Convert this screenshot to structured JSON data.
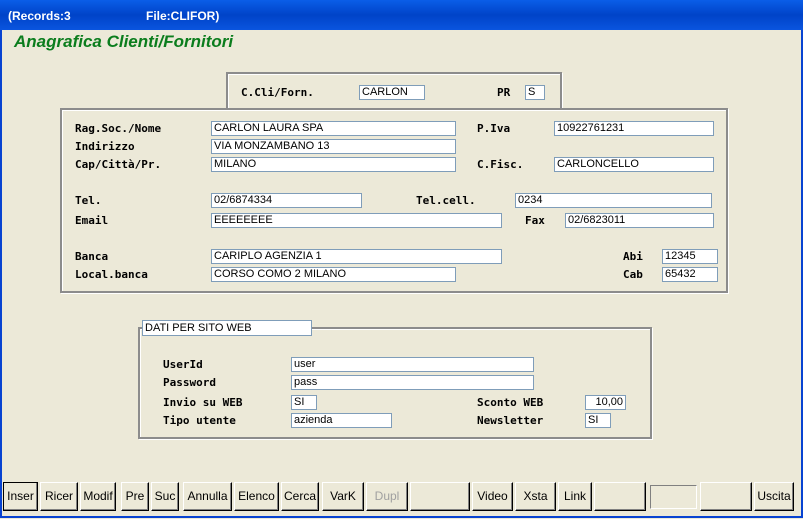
{
  "titlebar": {
    "records": "(Records:3",
    "file": "File:CLIFOR)"
  },
  "heading": "Anagrafica Clienti/Fornitori",
  "code": {
    "label": "C.Cli/Forn.",
    "value": "CARLON",
    "pr_label": "PR",
    "pr_value": "S"
  },
  "main": {
    "ragsoc_label": "Rag.Soc./Nome",
    "ragsoc": "CARLON LAURA SPA",
    "indirizzo_label": "Indirizzo",
    "indirizzo": "VIA MONZAMBANO 13",
    "cap_label": "Cap/Città/Pr.",
    "cap": "MILANO",
    "piva_label": "P.Iva",
    "piva": "10922761231",
    "cfisc_label": "C.Fisc.",
    "cfisc": "CARLONCELLO",
    "tel_label": "Tel.",
    "tel": "02/6874334",
    "telcell_label": "Tel.cell.",
    "telcell": "0234",
    "email_label": "Email",
    "email": "EEEEEEEE",
    "fax_label": "Fax",
    "fax": "02/6823011",
    "banca_label": "Banca",
    "banca": "CARIPLO  AGENZIA 1",
    "localbanca_label": "Local.banca",
    "localbanca": "CORSO COMO 2  MILANO",
    "abi_label": "Abi",
    "abi": "12345",
    "cab_label": "Cab",
    "cab": "65432"
  },
  "web": {
    "title": "DATI PER SITO WEB",
    "userid_label": "UserId",
    "userid": "user",
    "password_label": "Password",
    "password": "pass",
    "invio_label": "Invio su WEB",
    "invio": "SI",
    "sconto_label": "Sconto WEB",
    "sconto": "10,00",
    "tipo_label": "Tipo utente",
    "tipo": "azienda",
    "newsletter_label": "Newsletter",
    "newsletter": "SI"
  },
  "buttons": {
    "inser": "Inser",
    "ricer": "Ricer",
    "modif": "Modif",
    "pre": "Pre",
    "suc": "Suc",
    "annulla": "Annulla",
    "elenco": "Elenco",
    "cerca": "Cerca",
    "vark": "VarK",
    "dupl": "Dupl",
    "video": "Video",
    "xsta": "Xsta",
    "link": "Link",
    "uscita": "Uscita"
  }
}
